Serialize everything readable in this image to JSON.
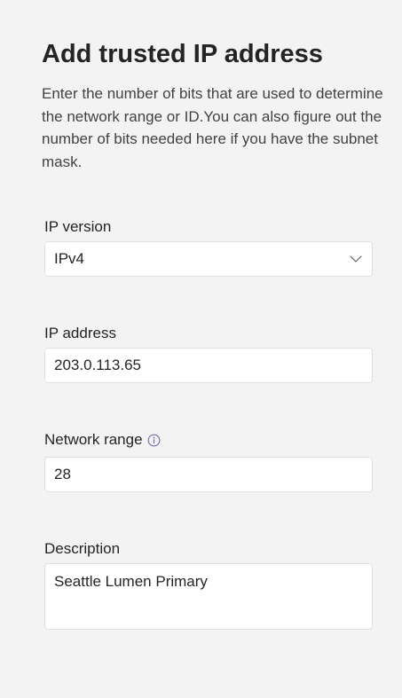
{
  "header": {
    "title": "Add trusted IP address",
    "description": "Enter the number of bits that are used to determine the network range or ID.You can also figure out the number of bits needed here if you have the subnet mask."
  },
  "form": {
    "ip_version": {
      "label": "IP version",
      "selected": "IPv4"
    },
    "ip_address": {
      "label": "IP address",
      "value": "203.0.113.65"
    },
    "network_range": {
      "label": "Network range",
      "value": "28",
      "info_icon": "info-icon"
    },
    "description": {
      "label": "Description",
      "value": "Seattle Lumen Primary"
    }
  },
  "colors": {
    "background": "#f3f3f3",
    "field_background": "#ffffff",
    "field_border": "#e1e1e1",
    "info_icon": "#6264a7"
  }
}
